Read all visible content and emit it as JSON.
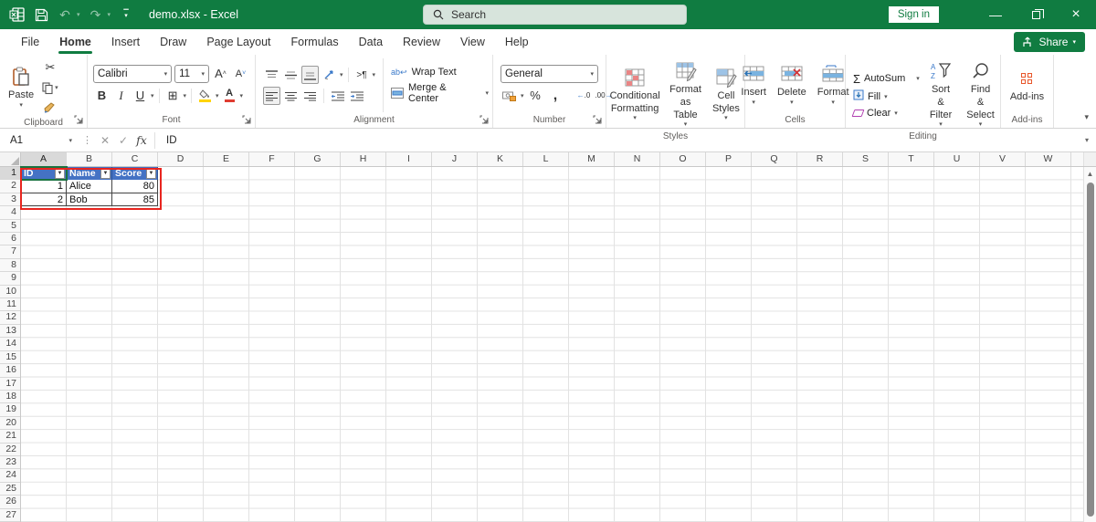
{
  "title_bar": {
    "title": "demo.xlsx  -  Excel",
    "search_placeholder": "Search",
    "sign_in": "Sign in"
  },
  "ribbon": {
    "tabs": [
      {
        "label": "File",
        "active": false
      },
      {
        "label": "Home",
        "active": true
      },
      {
        "label": "Insert",
        "active": false
      },
      {
        "label": "Draw",
        "active": false
      },
      {
        "label": "Page Layout",
        "active": false
      },
      {
        "label": "Formulas",
        "active": false
      },
      {
        "label": "Data",
        "active": false
      },
      {
        "label": "Review",
        "active": false
      },
      {
        "label": "View",
        "active": false
      },
      {
        "label": "Help",
        "active": false
      }
    ],
    "share_label": "Share",
    "clipboard": {
      "label": "Clipboard",
      "paste": "Paste"
    },
    "font": {
      "label": "Font",
      "font_name": "Calibri",
      "font_size": "11",
      "bold": "B",
      "italic": "I",
      "underline": "U"
    },
    "alignment": {
      "label": "Alignment",
      "wrap_text": "Wrap Text",
      "merge_center": "Merge & Center"
    },
    "number": {
      "label": "Number",
      "format": "General",
      "percent": "%",
      "comma": ","
    },
    "styles": {
      "label": "Styles",
      "conditional_formatting": "Conditional Formatting",
      "format_as_table": "Format as Table",
      "cell_styles": "Cell Styles"
    },
    "cells": {
      "label": "Cells",
      "insert": "Insert",
      "delete": "Delete",
      "format": "Format"
    },
    "editing": {
      "label": "Editing",
      "autosum": "AutoSum",
      "fill": "Fill",
      "clear": "Clear",
      "sort_filter": "Sort & Filter",
      "find_select": "Find & Select"
    },
    "addins": {
      "label": "Add-ins",
      "button": "Add-ins"
    }
  },
  "formula_bar": {
    "name_box": "A1",
    "fx": "fx",
    "formula": "ID"
  },
  "sheet": {
    "columns": [
      "A",
      "B",
      "C",
      "D",
      "E",
      "F",
      "G",
      "H",
      "I",
      "J",
      "K",
      "L",
      "M",
      "N",
      "O",
      "P",
      "Q",
      "R",
      "S",
      "T",
      "U",
      "V",
      "W"
    ],
    "rows": [
      1,
      2,
      3,
      4,
      5,
      6,
      7,
      8,
      9,
      10,
      11,
      12,
      13,
      14,
      15,
      16,
      17,
      18,
      19,
      20,
      21,
      22,
      23,
      24,
      25,
      26,
      27
    ],
    "selected_cell": "A1",
    "selected_column": "A",
    "selected_row": 1,
    "table": {
      "headers": [
        "ID",
        "Name",
        "Score"
      ],
      "data": [
        [
          "1",
          "Alice",
          "80"
        ],
        [
          "2",
          "Bob",
          "85"
        ]
      ],
      "header_bg": "#4472C4",
      "annotation_color": "#e8251f"
    }
  },
  "colors": {
    "brand_green": "#107C41",
    "table_header_blue": "#4472C4",
    "annotation_red": "#e8251f"
  }
}
